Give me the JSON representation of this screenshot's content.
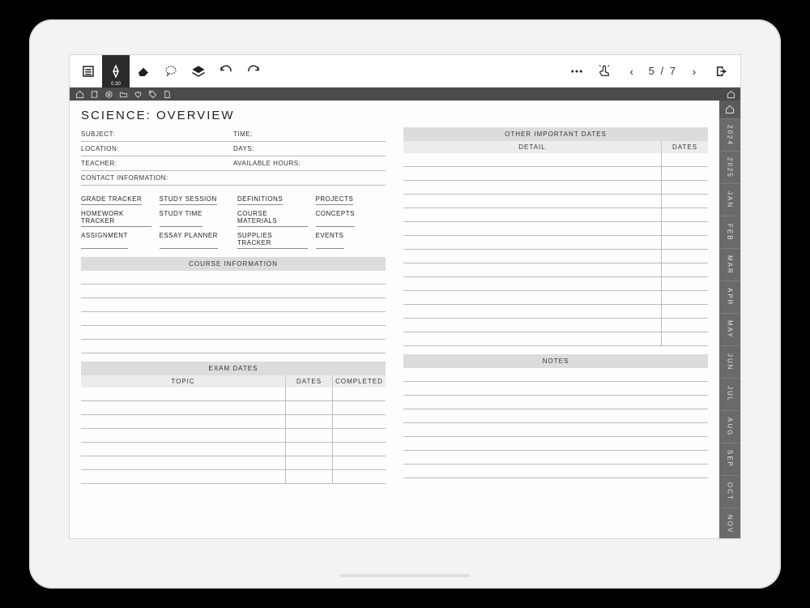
{
  "toolbar": {
    "pen_size": "0.30",
    "page_indicator": "5 / 7"
  },
  "page": {
    "title": "SCIENCE: OVERVIEW",
    "fields_left": [
      "SUBJECT:",
      "LOCATION:",
      "TEACHER:",
      "CONTACT INFORMATION:"
    ],
    "fields_right": [
      "TIME:",
      "DAYS:",
      "AVAILABLE HOURS:",
      ""
    ],
    "links": [
      "GRADE TRACKER",
      "STUDY SESSION",
      "DEFINITIONS",
      "PROJECTS",
      "HOMEWORK TRACKER",
      "STUDY TIME",
      "COURSE MATERIALS",
      "CONCEPTS",
      "ASSIGNMENT",
      "ESSAY PLANNER",
      "SUPPLIES TRACKER",
      "EVENTS"
    ],
    "course_info_header": "COURSE INFORMATION",
    "exam_header": "EXAM DATES",
    "exam_cols": {
      "topic": "TOPIC",
      "dates": "DATES",
      "completed": "COMPLETED"
    },
    "other_dates_header": "OTHER IMPORTANT DATES",
    "other_cols": {
      "detail": "DETAIL",
      "dates": "DATES"
    },
    "notes_header": "NOTES"
  },
  "sidetabs": [
    "2024",
    "2025",
    "JAN",
    "FEB",
    "MAR",
    "APR",
    "MAY",
    "JUN",
    "JUL",
    "AUG",
    "SEP",
    "OCT",
    "NOV"
  ]
}
